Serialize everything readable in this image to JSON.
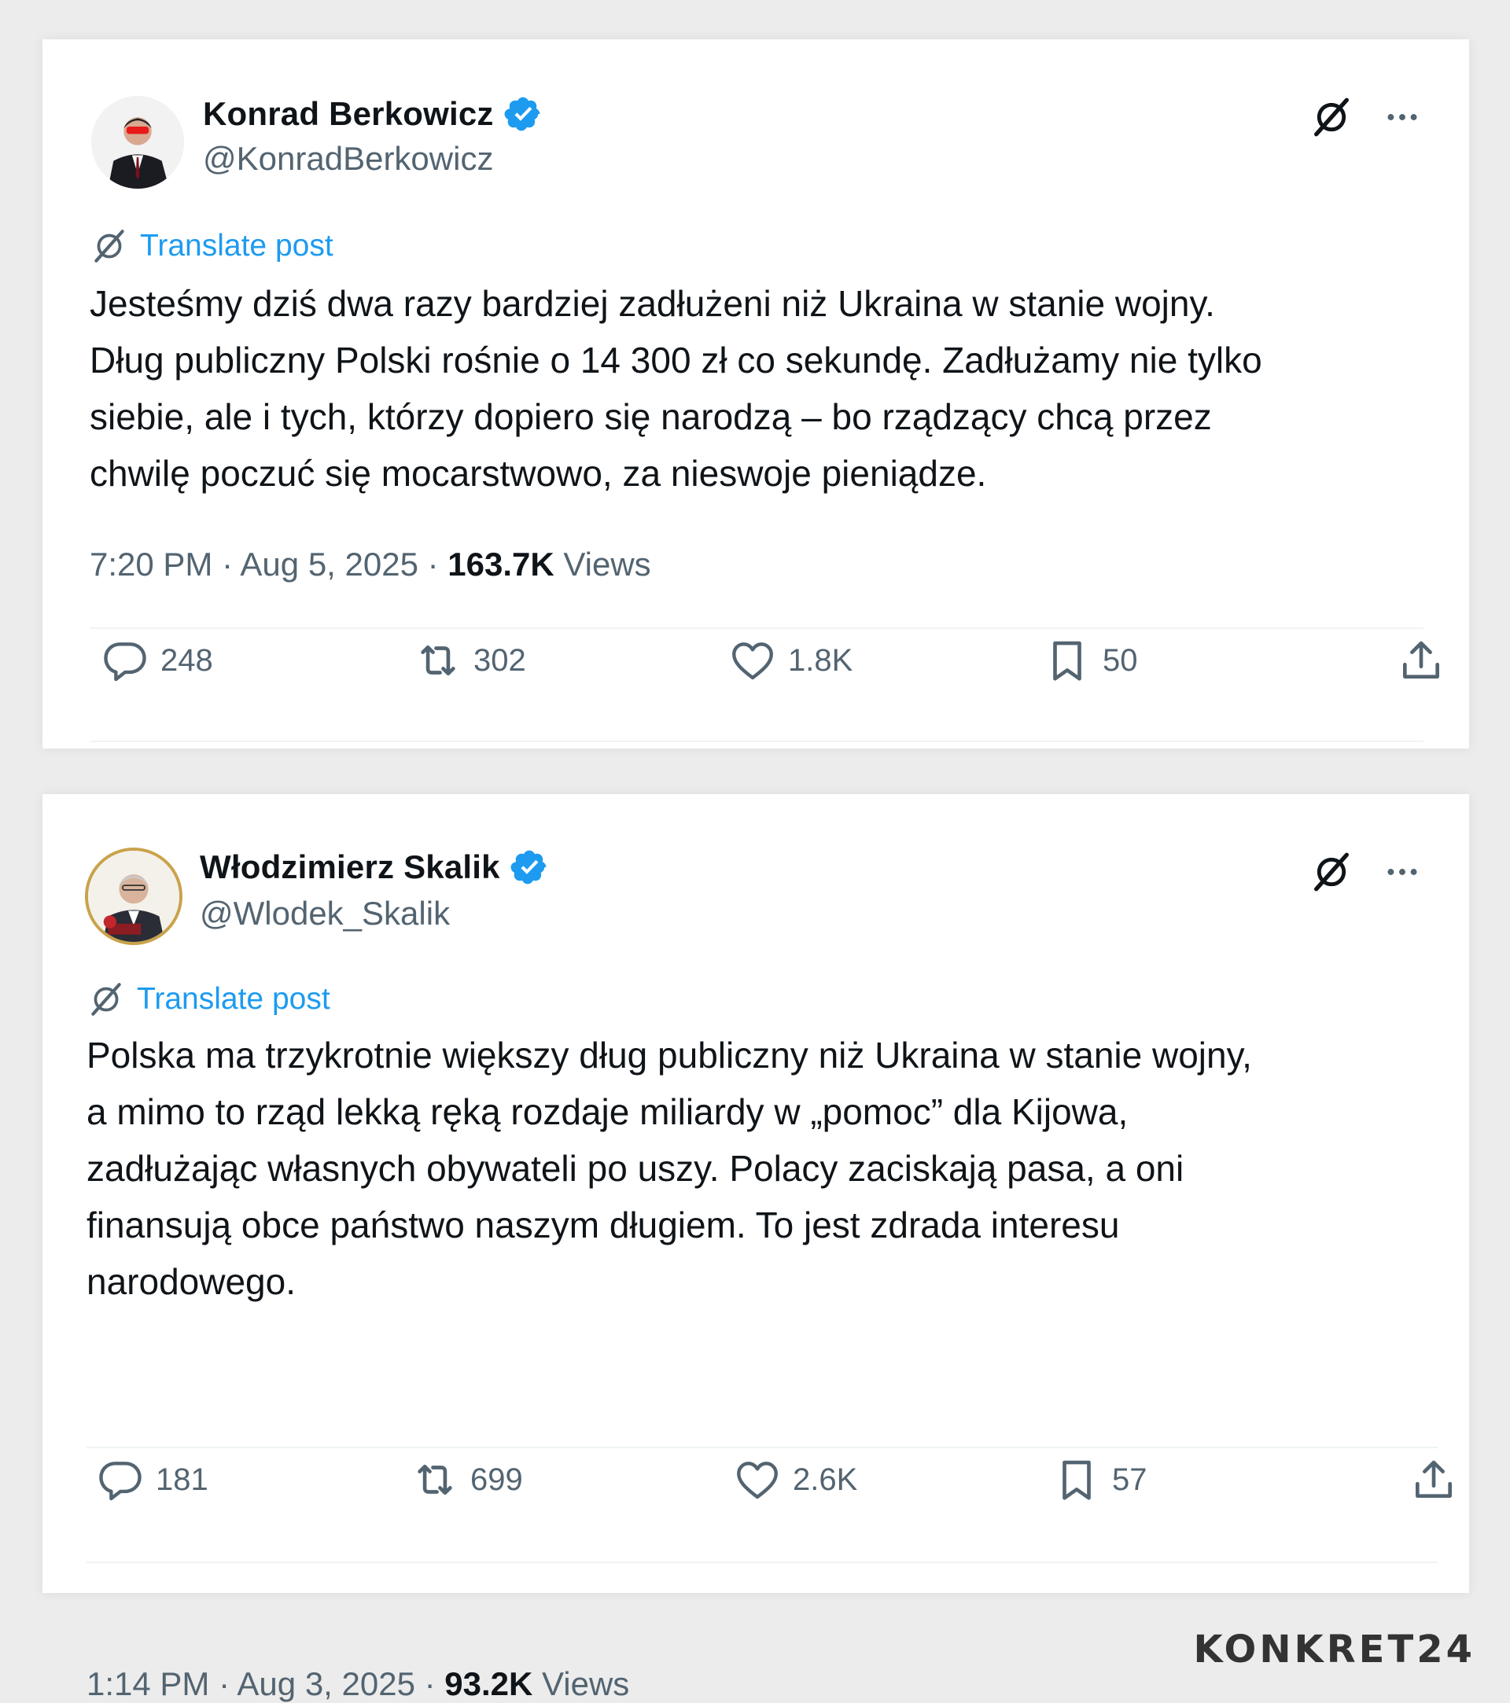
{
  "posts": [
    {
      "author": "Konrad Berkowicz",
      "handle": "@KonradBerkowicz",
      "translate_label": "Translate post",
      "text": "Jesteśmy dziś dwa razy bardziej zadłużeni niż Ukraina w stanie wojny.\nDług publiczny Polski rośnie o 14 300 zł co sekundę. Zadłużamy nie tylko\nsiebie, ale i tych, którzy dopiero się narodzą – bo rządzący chcą przez\nchwilę poczuć się mocarstwowo, za nieswoje pieniądze.",
      "time": "7:20 PM · Aug 5, 2025 · ",
      "views_count": "163.7K",
      "views_label": " Views",
      "replies": "248",
      "reposts": "302",
      "likes": "1.8K",
      "bookmarks": "50"
    },
    {
      "author": "Włodzimierz Skalik",
      "handle": "@Wlodek_Skalik",
      "translate_label": "Translate post",
      "text": "Polska ma trzykrotnie większy dług publiczny niż Ukraina w stanie wojny,\na mimo to rząd lekką ręką rozdaje miliardy w „pomoc” dla Kijowa,\nzadłużając własnych obywateli po uszy. Polacy zaciskają pasa, a oni\nfinansują obce państwo naszym długiem. To jest zdrada interesu\nnarodowego.",
      "time": "1:14 PM · Aug 3, 2025 · ",
      "views_count": "93.2K",
      "views_label": " Views",
      "replies": "181",
      "reposts": "699",
      "likes": "2.6K",
      "bookmarks": "57"
    }
  ],
  "watermark": "KONKRET24",
  "colors": {
    "accent": "#1d9bf0",
    "secondary_text": "#536471",
    "primary_text": "#0f1419",
    "background": "#ececec"
  },
  "icons": [
    "grok-icon",
    "more-icon",
    "verified-badge-icon",
    "translate-icon",
    "reply-icon",
    "repost-icon",
    "like-icon",
    "bookmark-icon",
    "share-icon"
  ]
}
